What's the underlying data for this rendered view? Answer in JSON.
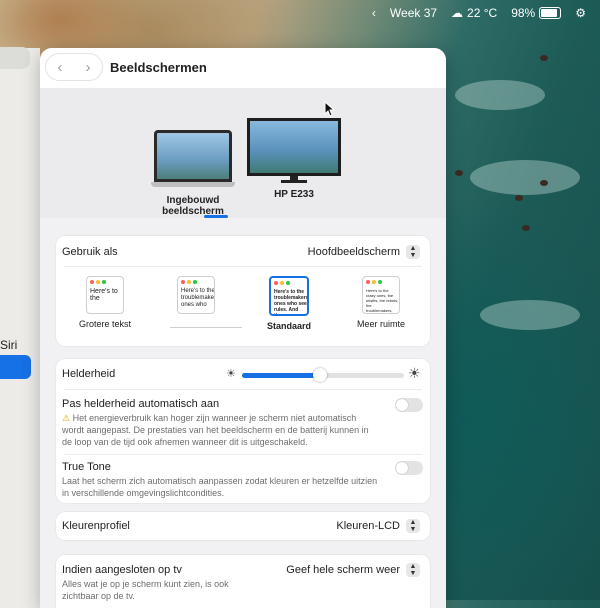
{
  "menubar": {
    "week": "Week 37",
    "weather": "22 °C",
    "battery": "98%"
  },
  "sidebar": {
    "siri_label": "Siri"
  },
  "window": {
    "title": "Beeldschermen"
  },
  "displays": [
    {
      "label": "Ingebouwd beeldscherm"
    },
    {
      "label": "HP E233"
    }
  ],
  "usage": {
    "label": "Gebruik als",
    "value": "Hoofdbeeldscherm"
  },
  "resolutions": [
    {
      "label": "Grotere tekst",
      "preview": "Here's to the"
    },
    {
      "label": "",
      "preview": "Here's to the troublemakers. ones who"
    },
    {
      "label": "Standaard",
      "preview": "Here's to the troublemakers. ones who see rules. And they"
    },
    {
      "label": "Meer ruimte",
      "preview": "Here's to the crazy ones, the misfits, the rebels, the troublemakers, the round pegs in the square holes"
    }
  ],
  "brightness": {
    "label": "Helderheid",
    "level": 0.48
  },
  "auto_brightness": {
    "label": "Pas helderheid automatisch aan",
    "description": "Het energieverbruik kan hoger zijn wanneer je scherm niet automatisch wordt aangepast. De prestaties van het beeldscherm en de batterij kunnen in de loop van de tijd ook afnemen wanneer dit is uitgeschakeld."
  },
  "true_tone": {
    "label": "True Tone",
    "description": "Laat het scherm zich automatisch aanpassen zodat kleuren er hetzelfde uitzien in verschillende omgevingslichtcondities."
  },
  "color_profile": {
    "label": "Kleurenprofiel",
    "value": "Kleuren-LCD"
  },
  "tv": {
    "label": "Indien aangesloten op tv",
    "value": "Geef hele scherm weer",
    "description": "Alles wat je op je scherm kunt zien, is ook zichtbaar op de tv."
  },
  "colors": {
    "accent": "#1670e6"
  }
}
